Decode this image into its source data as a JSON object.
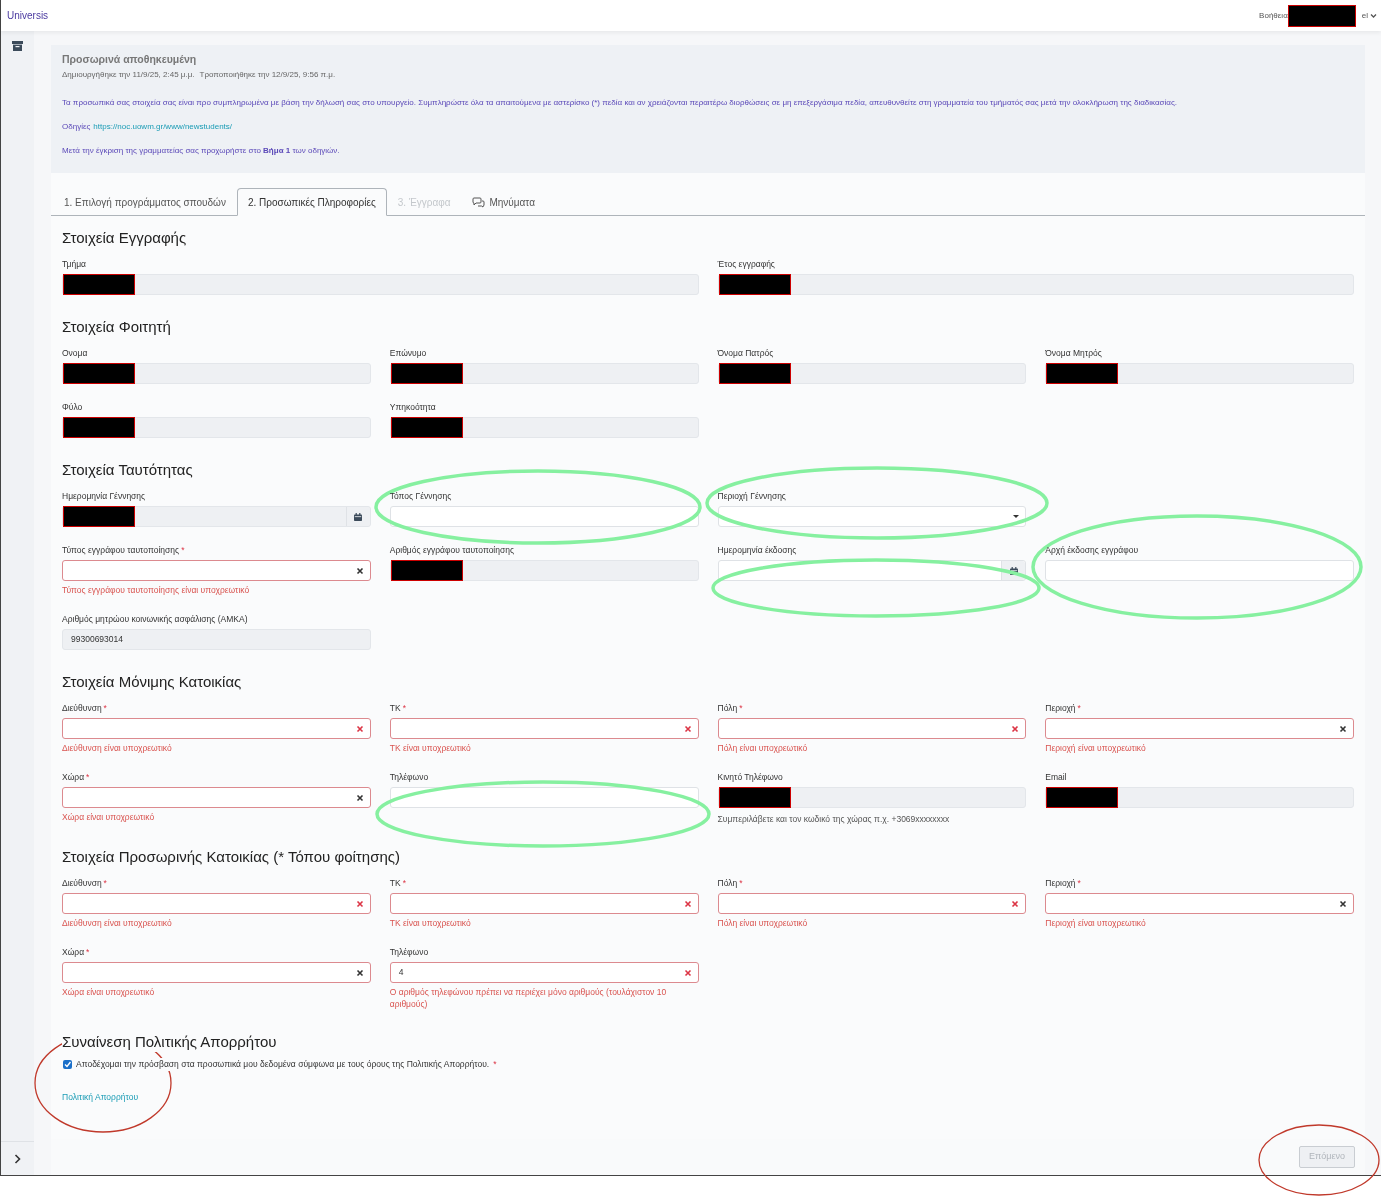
{
  "header": {
    "brand": "Universis",
    "help": "Βοήθεια",
    "account_redacted": true,
    "language": "el"
  },
  "notice": {
    "title": "Προσωρινά αποθηκευμένη",
    "created": "Δημιουργήθηκε την 11/9/25, 2:45 μ.μ.",
    "modified": "Τροποποιήθηκε την 12/9/25, 9:56 π.μ.",
    "message": "Τα προσωπικά σας στοιχεία σας είναι προ συμπληρωμένα με βάση την δήλωσή σας στο υπουργείο. Συμπληρώστε όλα τα απαιτούμενα με αστερίσκο (*) πεδία και αν χρειάζονται περαιτέρω διορθώσεις σε μη επεξεργάσιμα πεδία, απευθυνθείτε στη γραμματεία του τμήματός σας μετά την ολοκλήρωση της διαδικασίας.",
    "instructions_label": "Οδηγίες",
    "instructions_link": "https://noc.uowm.gr/www/newstudents/",
    "next_step": "Μετά την έγκριση της γραμματείας σας προχωρήστε στο **Βήμα 1** των οδηγιών."
  },
  "tabs": [
    {
      "label": "1. Επιλογή προγράμματος σπουδών",
      "selected": false,
      "disabled": false
    },
    {
      "label": "2. Προσωπικές Πληροφορίες",
      "selected": true,
      "disabled": false
    },
    {
      "label": "3. Έγγραφα",
      "selected": false,
      "disabled": true
    },
    {
      "label": "Μηνύματα",
      "selected": false,
      "disabled": false,
      "kind": "messages"
    }
  ],
  "registration": {
    "title": "Στοιχεία Εγγραφής",
    "fields": [
      {
        "label": "Τμήμα",
        "kind": "input",
        "readonly": true,
        "redacted": true
      },
      {
        "label": "Έτος εγγραφής",
        "kind": "input",
        "readonly": true,
        "redacted": true
      }
    ]
  },
  "sections": [
    {
      "title": "Στοιχεία Φοιτητή",
      "rows": [
        [
          {
            "label": "Ονομα",
            "kind": "input",
            "readonly": true,
            "redacted": true
          },
          {
            "label": "Επώνυμο",
            "kind": "input",
            "readonly": true,
            "redacted": true
          },
          {
            "label": "Όνομα Πατρός",
            "kind": "input",
            "readonly": true,
            "redacted": true
          },
          {
            "label": "Όνομα Μητρός",
            "kind": "input",
            "readonly": true,
            "redacted": true
          }
        ],
        [
          {
            "label": "Φύλο",
            "kind": "input",
            "readonly": true,
            "redacted": true
          },
          {
            "label": "Υπηκοότητα",
            "kind": "input",
            "readonly": true,
            "redacted": true
          }
        ]
      ]
    },
    {
      "title": "Στοιχεία Ταυτότητας",
      "rows": [
        [
          {
            "label": "Ημερομηνία Γέννησης",
            "kind": "date",
            "readonly": true,
            "redacted": true
          },
          {
            "label": "Τόπος Γέννησης",
            "kind": "input",
            "readonly": false
          },
          {
            "label": "Περιοχή Γέννησης",
            "kind": "select",
            "readonly": false
          }
        ],
        [
          {
            "label": "Τύπος εγγράφου ταυτοποίησης",
            "required_mark": "*",
            "kind": "select",
            "readonly": false,
            "invalid": true,
            "error": "Τύπος εγγράφου ταυτοποίησης είναι υποχρεωτικό"
          },
          {
            "label": "Αριθμός εγγράφου ταυτοποίησης",
            "kind": "input",
            "readonly": true,
            "redacted": true
          },
          {
            "label": "Ημερομηνία έκδοσης",
            "kind": "date",
            "readonly": false
          },
          {
            "label": "Αρχή έκδοσης εγγράφου",
            "kind": "input",
            "readonly": false
          }
        ],
        [
          {
            "label": "Αριθμός μητρώου κοινωνικής ασφάλισης (ΑΜΚΑ)",
            "kind": "input",
            "readonly": true,
            "value": "99300693014"
          }
        ]
      ]
    },
    {
      "title": "Στοιχεία Μόνιμης Κατοικίας",
      "rows": [
        [
          {
            "label": "Διεύθυνση",
            "required_mark": "*",
            "kind": "input",
            "readonly": false,
            "invalid": true,
            "error": "Διεύθυνση είναι υποχρεωτικό"
          },
          {
            "label": "ΤΚ",
            "required_mark": "*",
            "kind": "input",
            "readonly": false,
            "invalid": true,
            "error": "ΤΚ είναι υποχρεωτικό"
          },
          {
            "label": "Πόλη",
            "required_mark": "*",
            "kind": "input",
            "readonly": false,
            "invalid": true,
            "error": "Πόλη είναι υποχρεωτικό"
          },
          {
            "label": "Περιοχή",
            "required_mark": "*",
            "kind": "select",
            "readonly": false,
            "invalid": true,
            "error": "Περιοχή είναι υποχρεωτικό"
          }
        ],
        [
          {
            "label": "Χώρα",
            "required_mark": "*",
            "kind": "select",
            "readonly": false,
            "invalid": true,
            "error": "Χώρα είναι υποχρεωτικό"
          },
          {
            "label": "Τηλέφωνο",
            "kind": "input",
            "readonly": false
          },
          {
            "label": "Κινητό Τηλέφωνο",
            "kind": "input",
            "readonly": true,
            "redacted": true,
            "help": "Συμπεριλάβετε και τον κωδικό της χώρας π.χ. +3069xxxxxxxx"
          },
          {
            "label": "Email",
            "kind": "input",
            "readonly": true,
            "redacted": true
          }
        ]
      ]
    },
    {
      "title": "Στοιχεία Προσωρινής Κατοικίας (* Τόπου φοίτησης)",
      "rows": [
        [
          {
            "label": "Διεύθυνση",
            "required_mark": "*",
            "kind": "input",
            "readonly": false,
            "invalid": true,
            "error": "Διεύθυνση είναι υποχρεωτικό"
          },
          {
            "label": "ΤΚ",
            "required_mark": "*",
            "kind": "input",
            "readonly": false,
            "invalid": true,
            "error": "ΤΚ είναι υποχρεωτικό"
          },
          {
            "label": "Πόλη",
            "required_mark": "*",
            "kind": "input",
            "readonly": false,
            "invalid": true,
            "error": "Πόλη είναι υποχρεωτικό"
          },
          {
            "label": "Περιοχή",
            "required_mark": "*",
            "kind": "select",
            "readonly": false,
            "invalid": true,
            "error": "Περιοχή είναι υποχρεωτικό"
          }
        ],
        [
          {
            "label": "Χώρα",
            "required_mark": "*",
            "kind": "select",
            "readonly": false,
            "invalid": true,
            "error": "Χώρα είναι υποχρεωτικό"
          },
          {
            "label": "Τηλέφωνο",
            "kind": "input",
            "readonly": false,
            "invalid": true,
            "value": "4",
            "error": "Ο αριθμός τηλεφώνου πρέπει να περιέχει μόνο αριθμούς (τουλάχιστον 10 αριθμούς)"
          }
        ]
      ]
    }
  ],
  "consent": {
    "title": "Συναίνεση Πολιτικής Απορρήτου",
    "checked": true,
    "label": "Αποδέχομαι την πρόσβαση στα προσωπικά μου δεδομένα σύμφωνα με τους όρους της Πολιτικής Απορρήτου.",
    "required_mark": "*",
    "link": "Πολιτική Απορρήτου"
  },
  "next_button": {
    "label": "Επόμενο",
    "disabled": true
  },
  "annotations": [
    {
      "kind": "ellipse",
      "color": "#86f0a0"
    },
    {
      "kind": "ellipse",
      "color": "#86f0a0"
    },
    {
      "kind": "ellipse",
      "color": "#86f0a0"
    },
    {
      "kind": "ellipse",
      "color": "#86f0a0"
    },
    {
      "kind": "ellipse",
      "color": "#86f0a0"
    },
    {
      "kind": "ellipse",
      "color": "#c0392b"
    },
    {
      "kind": "ellipse",
      "color": "#c0392b"
    }
  ]
}
